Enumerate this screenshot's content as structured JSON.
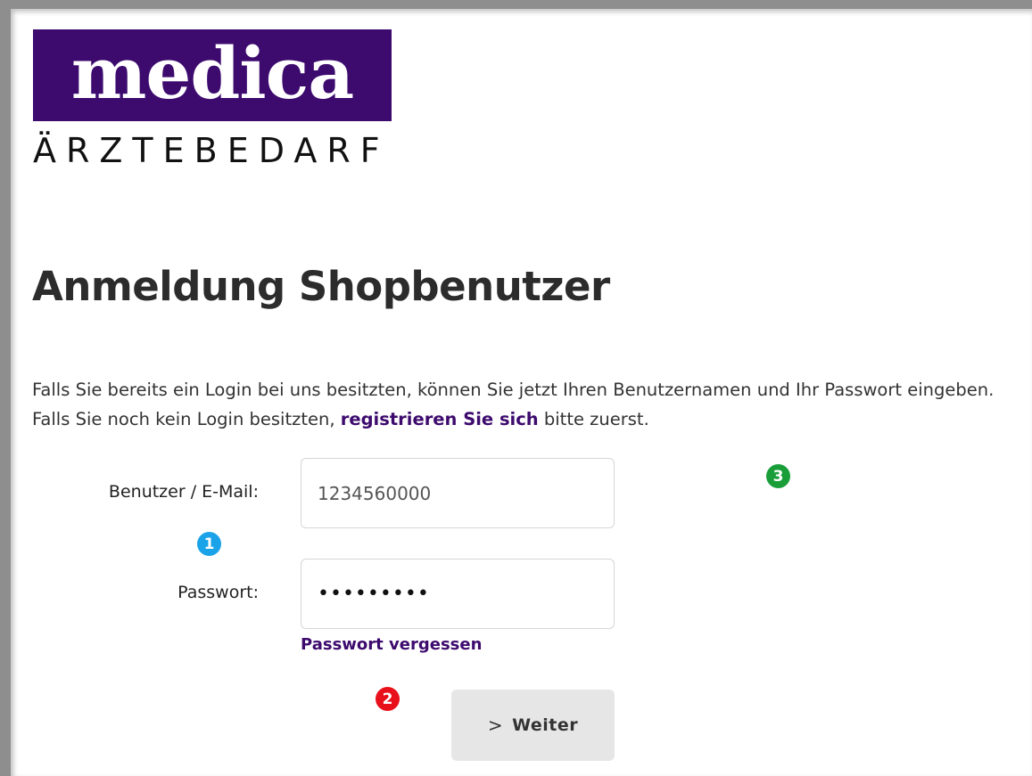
{
  "logo": {
    "word": "medica",
    "subtitle": "ÄRZTEBEDARF",
    "bg_color": "#3d0a6e"
  },
  "page": {
    "title": "Anmeldung Shopbenutzer",
    "intro_before": "Falls Sie bereits ein Login bei uns besitzten, können Sie jetzt Ihren Benutzernamen und Ihr Passwort eingeben. Falls Sie noch kein Login besitzten, ",
    "intro_link": "registrieren Sie sich",
    "intro_after": " bitte zuerst."
  },
  "form": {
    "user_label": "Benutzer / E-Mail:",
    "user_value": "1234560000",
    "password_label": "Passwort:",
    "password_value": "•••••••••",
    "forgot_link": "Passwort vergessen",
    "submit_chevron": ">",
    "submit_label": "Weiter"
  },
  "badges": [
    {
      "label": "1",
      "color": "#1aa3e8"
    },
    {
      "label": "2",
      "color": "#e8101a"
    },
    {
      "label": "3",
      "color": "#1a9e3a"
    }
  ],
  "colors": {
    "accent": "#3d0a6e",
    "button_bg": "#e6e6e6"
  }
}
